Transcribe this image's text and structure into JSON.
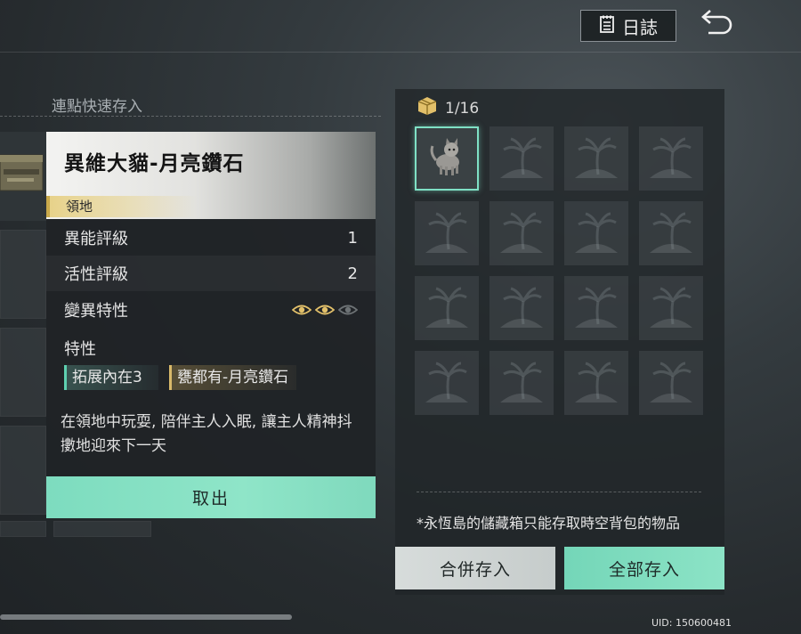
{
  "header": {
    "log_label": "日誌"
  },
  "left": {
    "quick_deposit_label": "連點快速存入"
  },
  "detail": {
    "title": "異維大貓-月亮鑽石",
    "tag": "領地",
    "rows": [
      {
        "label": "異能評級",
        "value": "1"
      },
      {
        "label": "活性評級",
        "value": "2"
      },
      {
        "label": "變異特性",
        "value": ""
      }
    ],
    "mutation_eyes": {
      "filled": 2,
      "total": 3
    },
    "traits_title": "特性",
    "traits": [
      "拓展內在3",
      "甕都有-月亮鑽石"
    ],
    "description": "在領地中玩耍, 陪伴主人入眠, 讓主人精神抖擻地迎來下一天",
    "take_button": "取出"
  },
  "storage": {
    "count": "1/16",
    "note": "*永恆島的儲藏箱只能存取時空背包的物品",
    "merge_button": "合併存入",
    "all_button": "全部存入"
  },
  "footer": {
    "uid": "UID: 150600481"
  },
  "colors": {
    "accent": "#7fe0c5",
    "gold": "#e2c06a"
  }
}
